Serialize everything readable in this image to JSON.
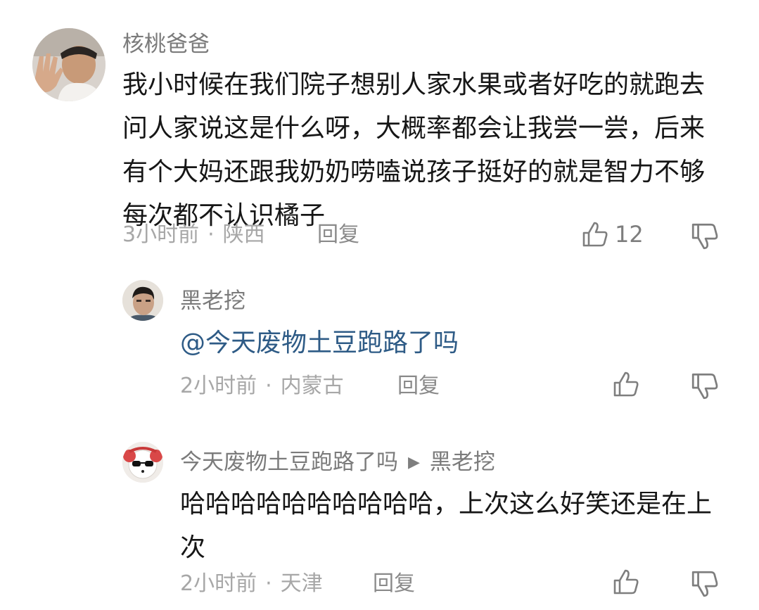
{
  "comments": [
    {
      "author": "核桃爸爸",
      "text": "我小时候在我们院子想别人家水果或者好吃的就跑去问人家说这是什么呀，大概率都会让我尝一尝，后来有个大妈还跟我奶奶唠嗑说孩子挺好的就是智力不够每次都不认识橘子",
      "time": "3小时前",
      "location": "陕西",
      "reply_label": "回复",
      "like_count": "12"
    },
    {
      "author": "黑老挖",
      "mention": "@今天废物土豆跑路了吗",
      "time": "2小时前",
      "location": "内蒙古",
      "reply_label": "回复"
    },
    {
      "author": "今天废物土豆跑路了吗",
      "reply_to": "黑老挖",
      "text": "哈哈哈哈哈哈哈哈哈哈，上次这么好笑还是在上次",
      "time": "2小时前",
      "location": "天津",
      "reply_label": "回复"
    }
  ],
  "separator": "·",
  "colors": {
    "name": "#7b7b7b",
    "text": "#161616",
    "meta": "#a7a7a7",
    "mention": "#2e5b86"
  },
  "icons": [
    "thumbs-up-icon",
    "thumbs-down-icon",
    "reply-arrow-icon"
  ]
}
